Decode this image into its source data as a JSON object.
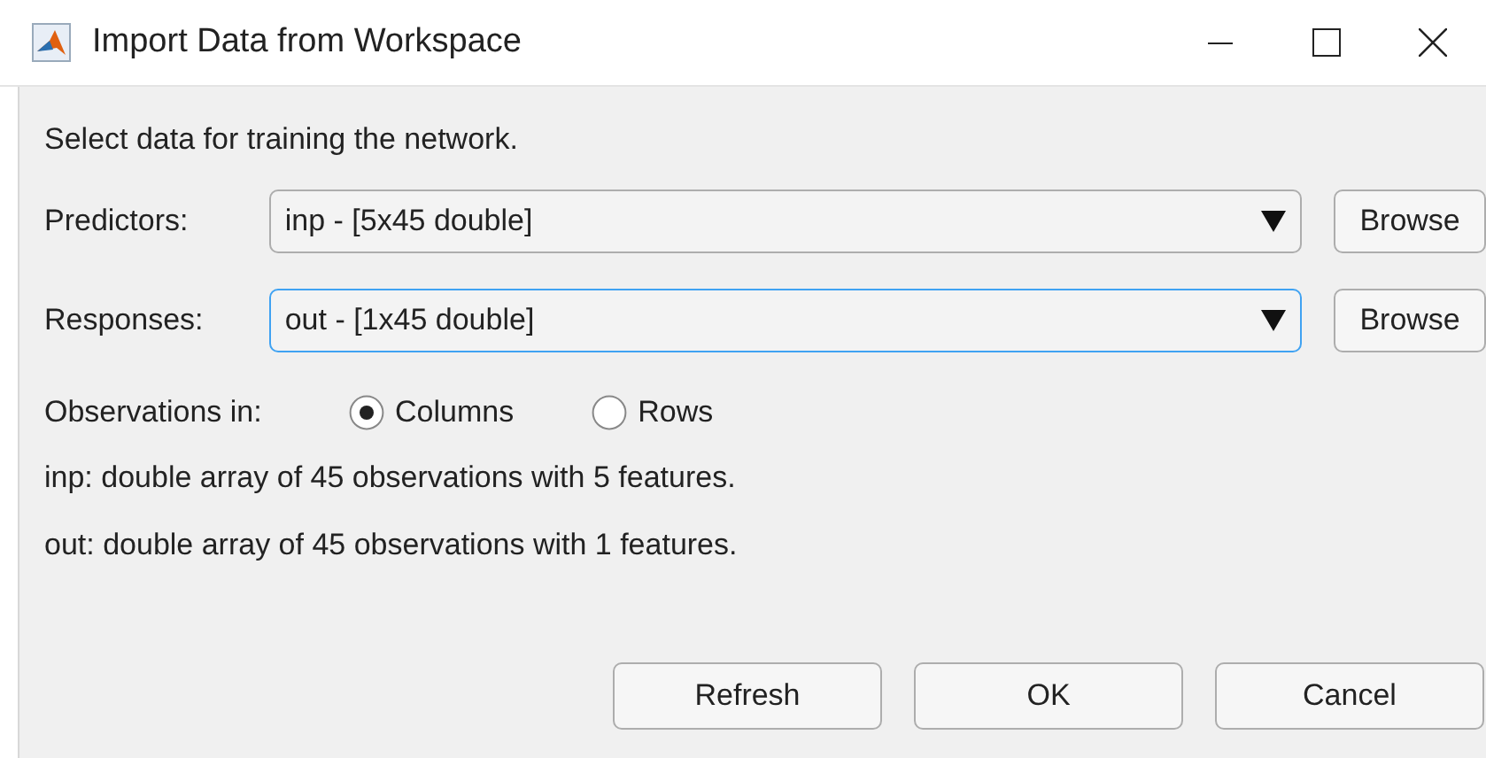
{
  "window": {
    "title": "Import Data from Workspace"
  },
  "instruction": "Select data for training the network.",
  "fields": [
    {
      "label": "Predictors:",
      "value": "inp - [5x45 double]",
      "focused": false,
      "button": "Browse"
    },
    {
      "label": "Responses:",
      "value": "out - [1x45 double]",
      "focused": true,
      "button": "Browse"
    }
  ],
  "observations": {
    "label": "Observations in:",
    "options": [
      {
        "label": "Columns",
        "selected": true
      },
      {
        "label": "Rows",
        "selected": false
      }
    ]
  },
  "info": [
    "inp: double array of 45 observations with 5 features.",
    "out: double array of 45 observations with 1 features."
  ],
  "buttons": [
    "Refresh",
    "OK",
    "Cancel"
  ]
}
